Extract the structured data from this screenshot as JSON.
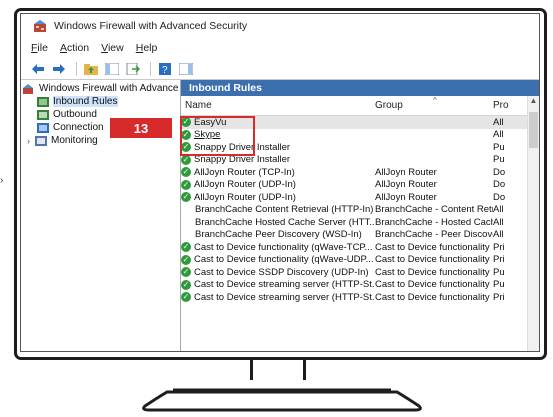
{
  "window": {
    "title": "Windows Firewall with Advanced Security"
  },
  "menu": [
    "File",
    "Action",
    "View",
    "Help"
  ],
  "tree": [
    {
      "label": "Windows Firewall with Advance",
      "level": 0,
      "icon": "firewall-icon",
      "selected": false
    },
    {
      "label": "Inbound Rules",
      "level": 1,
      "icon": "inbound-rules-icon",
      "selected": true
    },
    {
      "label": "Outbound",
      "level": 1,
      "icon": "outbound-rules-icon",
      "selected": false
    },
    {
      "label": "Connection",
      "level": 1,
      "icon": "connection-icon",
      "selected": false
    },
    {
      "label": "Monitoring",
      "level": 1,
      "icon": "monitoring-icon",
      "selected": false,
      "expandable": true
    }
  ],
  "main": {
    "header": "Inbound Rules",
    "columns": {
      "name": "Name",
      "group": "Group",
      "profile": "Pro"
    },
    "rows": [
      {
        "name": "EasyVu",
        "group": "",
        "profile": "All",
        "enabled": true,
        "selected": true
      },
      {
        "name": "Skype",
        "group": "",
        "profile": "All",
        "enabled": true
      },
      {
        "name": "Snappy Driver Installer",
        "group": "",
        "profile": "Pu",
        "enabled": true
      },
      {
        "name": "Snappy Driver Installer",
        "group": "",
        "profile": "Pu",
        "enabled": true
      },
      {
        "name": "AllJoyn Router (TCP-In)",
        "group": "AllJoyn Router",
        "profile": "Do",
        "enabled": true
      },
      {
        "name": "AllJoyn Router (UDP-In)",
        "group": "AllJoyn Router",
        "profile": "Do",
        "enabled": true
      },
      {
        "name": "AllJoyn Router (UDP-In)",
        "group": "AllJoyn Router",
        "profile": "Do",
        "enabled": true
      },
      {
        "name": "BranchCache Content Retrieval (HTTP-In)",
        "group": "BranchCache - Content Retr...",
        "profile": "All",
        "enabled": false
      },
      {
        "name": "BranchCache Hosted Cache Server (HTT...",
        "group": "BranchCache - Hosted Cach...",
        "profile": "All",
        "enabled": false
      },
      {
        "name": "BranchCache Peer Discovery (WSD-In)",
        "group": "BranchCache - Peer Discove...",
        "profile": "All",
        "enabled": false
      },
      {
        "name": "Cast to Device functionality (qWave-TCP...",
        "group": "Cast to Device functionality",
        "profile": "Pri",
        "enabled": true
      },
      {
        "name": "Cast to Device functionality (qWave-UDP...",
        "group": "Cast to Device functionality",
        "profile": "Pri",
        "enabled": true
      },
      {
        "name": "Cast to Device SSDP Discovery (UDP-In)",
        "group": "Cast to Device functionality",
        "profile": "Pu",
        "enabled": true
      },
      {
        "name": "Cast to Device streaming server (HTTP-St...",
        "group": "Cast to Device functionality",
        "profile": "Pu",
        "enabled": true
      },
      {
        "name": "Cast to Device streaming server (HTTP-St...",
        "group": "Cast to Device functionality",
        "profile": "Pri",
        "enabled": true
      }
    ]
  },
  "callout": {
    "number": "13"
  },
  "colors": {
    "accent": "#3b6fae",
    "callout": "#d72a2a",
    "enabled": "#2f9a3c"
  }
}
